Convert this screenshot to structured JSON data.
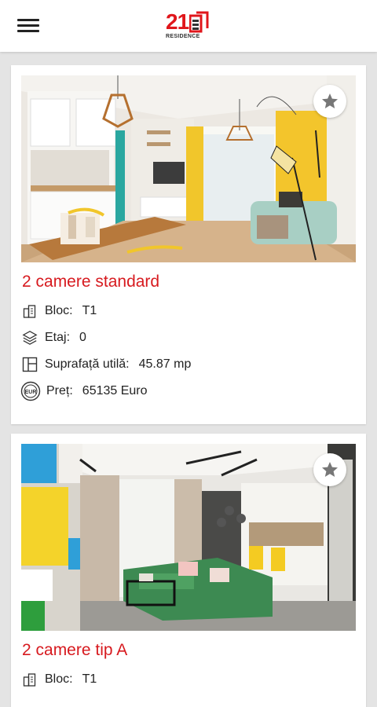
{
  "header": {
    "logo_number": "21",
    "logo_subtitle": "RESIDENCE",
    "menu_icon": "hamburger-menu-icon",
    "brand_color": "#e0161b"
  },
  "listings": [
    {
      "title": "2 camere standard",
      "bloc_label": "Bloc:",
      "bloc_value": "T1",
      "etaj_label": "Etaj:",
      "etaj_value": "0",
      "suprafata_label": "Suprafață utilă:",
      "suprafata_value": "45.87 mp",
      "pret_label": "Preț:",
      "pret_value": "65135 Euro",
      "favorite_icon": "star-icon"
    },
    {
      "title": "2 camere tip A",
      "bloc_label": "Bloc:",
      "bloc_value": "T1",
      "favorite_icon": "star-icon"
    }
  ],
  "colors": {
    "title_red": "#d71a1f",
    "background": "#e4e4e4"
  }
}
